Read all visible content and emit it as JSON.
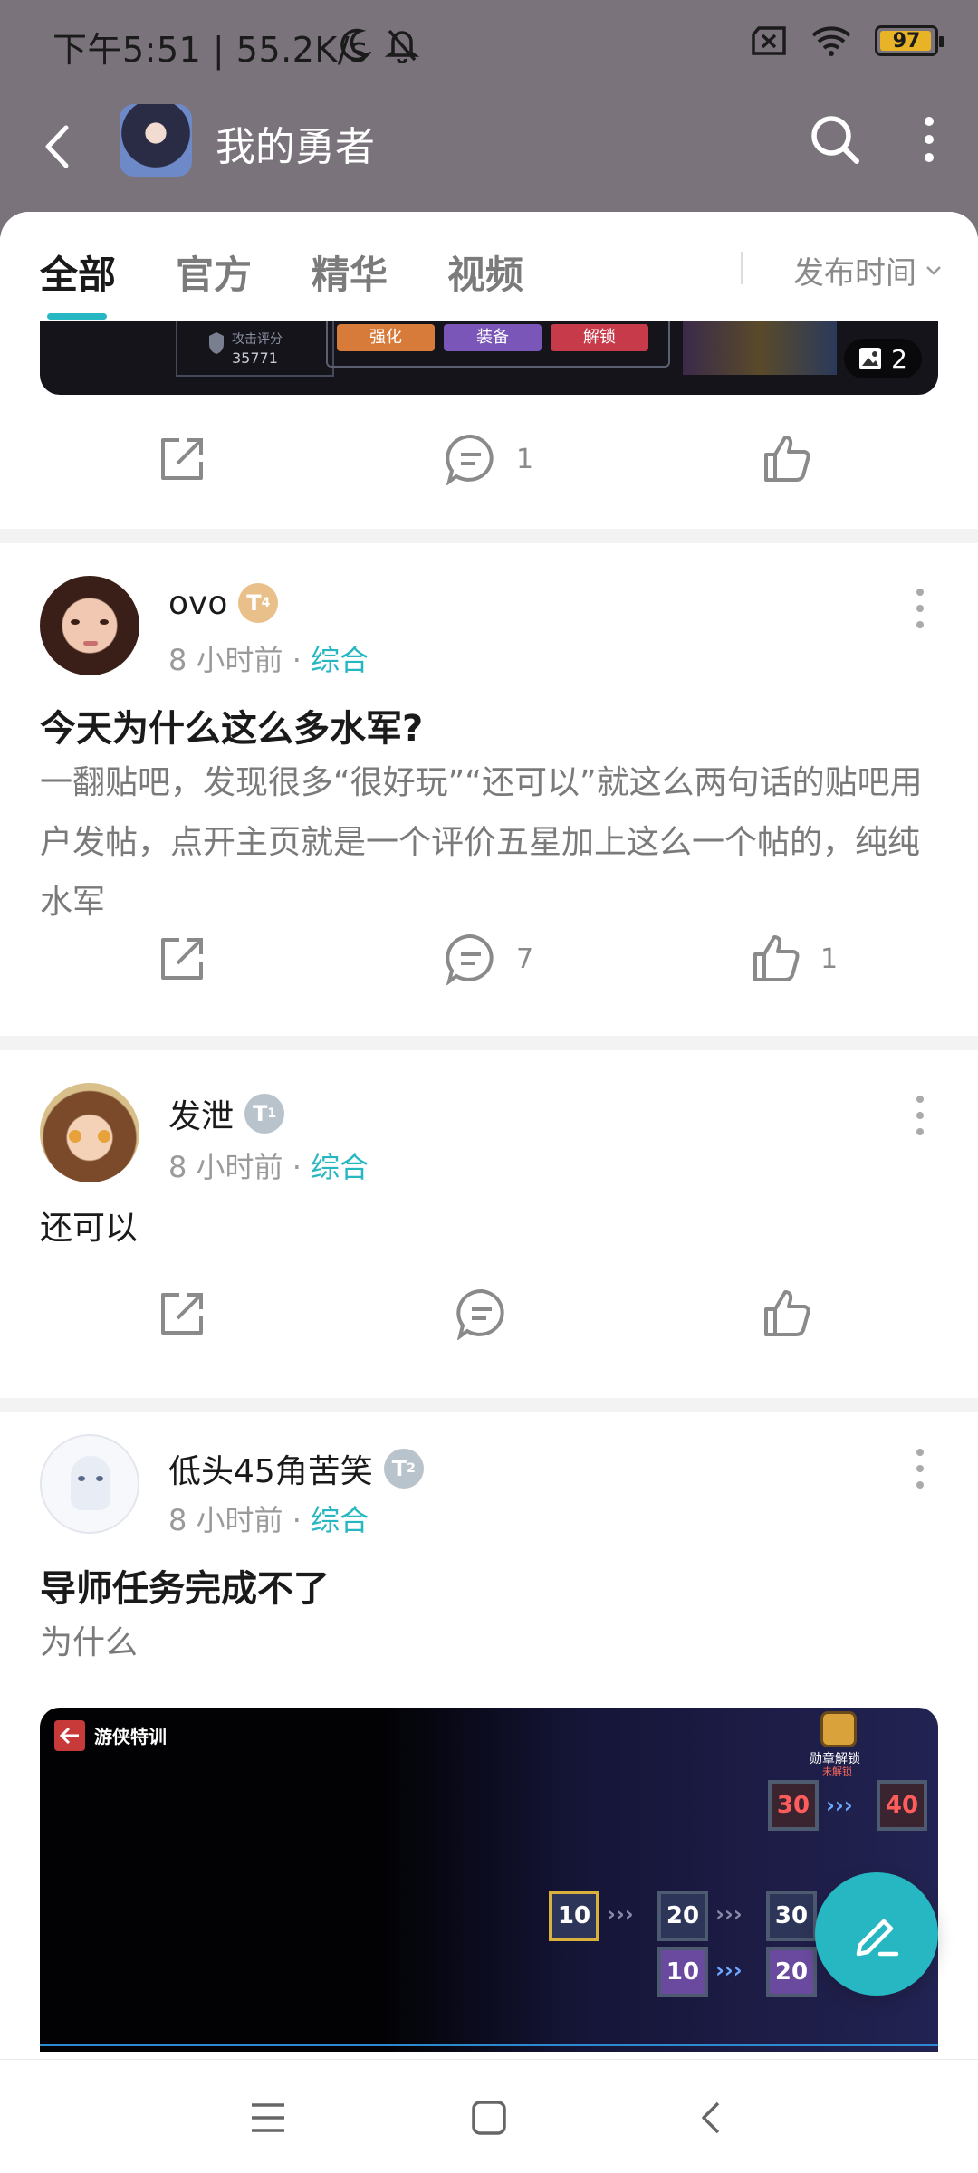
{
  "status_bar": {
    "left_text": "下午5:51 | 55.2K/s",
    "battery": "97",
    "battery_level_percent": 97
  },
  "header": {
    "title": "我的勇者",
    "back_icon": "chevron-left-icon",
    "search_icon": "search-icon",
    "more_icon": "more-vertical-icon"
  },
  "tabs": [
    {
      "label": "全部"
    },
    {
      "label": "官方"
    },
    {
      "label": "精华"
    },
    {
      "label": "视频"
    }
  ],
  "sort_label": "发布时间",
  "top_strip": {
    "score_label": "攻击评分",
    "score_value": "35771",
    "buttons": [
      "强化",
      "装备",
      "解锁"
    ],
    "image_count": "2"
  },
  "first_post_actions": {
    "comments": "1"
  },
  "posts": [
    {
      "username": "ovo",
      "level": "T",
      "level_sub": "4",
      "time": "8 小时前",
      "category": "综合",
      "title": "今天为什么这么多水军?",
      "body": "一翻贴吧，发现很多“很好玩”“还可以”就这么两句话的贴吧用户发帖，点开主页就是一个评价五星加上这么一个帖的，纯纯水军",
      "comments": "7",
      "likes": "1"
    },
    {
      "username": "发泄",
      "level": "T",
      "level_sub": "1",
      "time": "8 小时前",
      "category": "综合",
      "body": "还可以"
    },
    {
      "username": "低头45角苦笑",
      "level": "T",
      "level_sub": "2",
      "time": "8 小时前",
      "category": "综合",
      "title": "导师任务完成不了",
      "body": "为什么",
      "image": {
        "header_text": "游侠特训",
        "badge_text": "勋章解锁",
        "badge_sub": "未解锁",
        "tiles": [
          "30",
          "40",
          "10",
          "20",
          "30",
          "10",
          "20"
        ]
      }
    }
  ],
  "colors": {
    "accent": "#27b7c2",
    "header_bg": "#7a737b",
    "separator": "#f3f3f3"
  }
}
